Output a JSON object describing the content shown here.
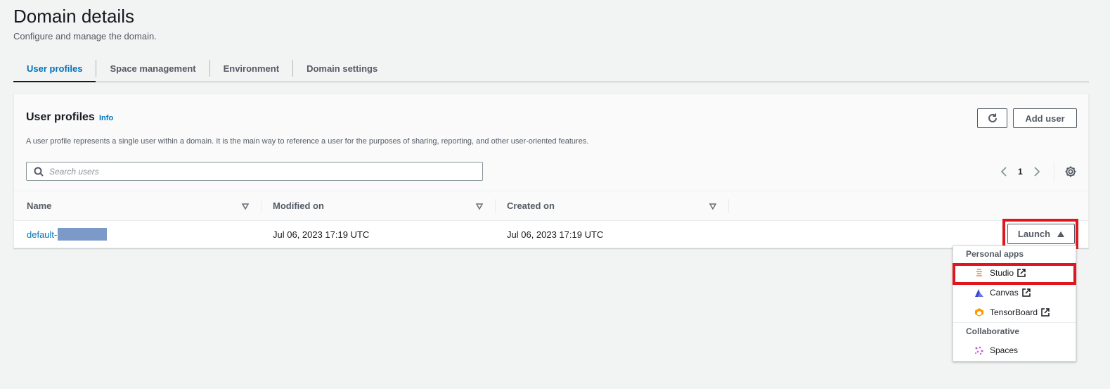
{
  "page": {
    "title": "Domain details",
    "subtitle": "Configure and manage the domain."
  },
  "tabs": [
    {
      "label": "User profiles",
      "active": true
    },
    {
      "label": "Space management",
      "active": false
    },
    {
      "label": "Environment",
      "active": false
    },
    {
      "label": "Domain settings",
      "active": false
    }
  ],
  "panel": {
    "title": "User profiles",
    "info": "Info",
    "description": "A user profile represents a single user within a domain. It is the main way to reference a user for the purposes of sharing, reporting, and other user-oriented features.",
    "refresh_icon": "refresh-icon",
    "add_user_label": "Add user"
  },
  "search": {
    "placeholder": "Search users",
    "value": ""
  },
  "pagination": {
    "current_page": "1"
  },
  "table": {
    "columns": [
      "Name",
      "Modified on",
      "Created on"
    ],
    "rows": [
      {
        "name": "default-",
        "name_redacted": true,
        "modified_on": "Jul 06, 2023 17:19 UTC",
        "created_on": "Jul 06, 2023 17:19 UTC"
      }
    ]
  },
  "launch": {
    "label": "Launch",
    "menu": {
      "groups": [
        {
          "label": "Personal apps",
          "items": [
            {
              "label": "Studio",
              "icon": "studio-icon",
              "external": true
            },
            {
              "label": "Canvas",
              "icon": "canvas-icon",
              "external": true
            },
            {
              "label": "TensorBoard",
              "icon": "tensorboard-icon",
              "external": true
            }
          ]
        },
        {
          "label": "Collaborative",
          "items": [
            {
              "label": "Spaces",
              "icon": "spaces-icon",
              "external": false
            }
          ]
        }
      ]
    }
  },
  "colors": {
    "link": "#0073bb",
    "highlight": "#e0161e",
    "redaction": "#7c9ac9"
  }
}
